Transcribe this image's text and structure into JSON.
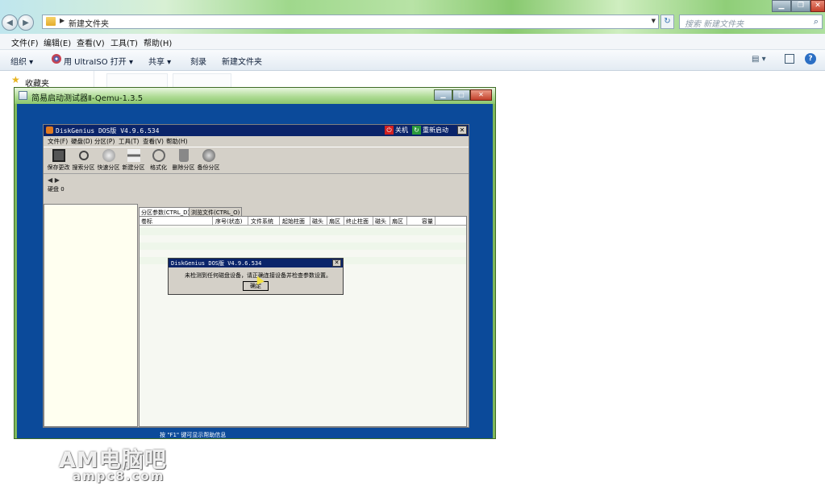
{
  "explorer": {
    "address": "新建文件夹",
    "search_placeholder": "搜索 新建文件夹",
    "menu": [
      "文件(F)",
      "编辑(E)",
      "查看(V)",
      "工具(T)",
      "帮助(H)"
    ],
    "commands": {
      "organize": "组织 ▾",
      "open_with": "用 UltraISO 打开 ▾",
      "share": "共享 ▾",
      "burn": "刻录",
      "new_folder": "新建文件夹"
    },
    "favorites": "收藏夹"
  },
  "qemu": {
    "title": "简易启动测试器Ⅱ-Qemu-1.3.5"
  },
  "diskgenius": {
    "title": "DiskGenius DOS版 V4.9.6.534",
    "shutdown": "关机",
    "restart": "重新启动",
    "menu": [
      "文件(F)",
      "硬盘(D)",
      "分区(P)",
      "工具(T)",
      "查看(V)",
      "帮助(H)"
    ],
    "toolbar": [
      "保存更改",
      "搜索分区",
      "快速分区",
      "新建分区",
      "格式化",
      "删除分区",
      "备份分区"
    ],
    "disk_label": "硬盘 0",
    "tabs": [
      "分区参数(CTRL_D)",
      "浏览文件(CTRL_O)"
    ],
    "columns": [
      "卷标",
      "序号(状态)",
      "文件系统",
      "起始柱面",
      "磁头",
      "扇区",
      "终止柱面",
      "磁头",
      "扇区",
      "容量"
    ],
    "status": "按 \"F1\" 键可显示帮助信息"
  },
  "dialog": {
    "title": "DiskGenius DOS版 V4.9.6.534",
    "message": "未检测到任何磁盘设备，请正确连接设备并检查参数设置。",
    "ok": "确定"
  },
  "watermark": {
    "line1": "AM电脑吧",
    "line2": "ampc8.com"
  }
}
